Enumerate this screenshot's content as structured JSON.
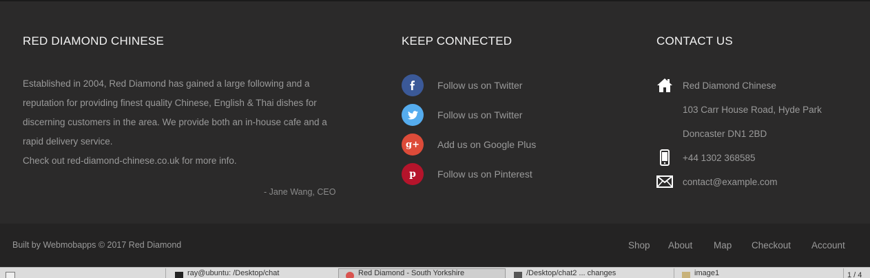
{
  "about": {
    "title": "RED DIAMOND CHINESE",
    "paragraph": "Established in 2004, Red Diamond has gained a large following and a reputation for providing finest quality Chinese, English & Thai dishes for discerning customers in the area. We provide both an in-house cafe and a rapid delivery service.",
    "more_info": "Check out red-diamond-chinese.co.uk for more info.",
    "quote_author": "- Jane Wang, CEO"
  },
  "social": {
    "title": "KEEP CONNECTED",
    "items": [
      {
        "icon": "facebook-icon",
        "glyph": "f",
        "color": "#3b5998",
        "label": "Follow us on Twitter"
      },
      {
        "icon": "twitter-icon",
        "glyph": "t",
        "color": "#55acee",
        "label": "Follow us on Twitter"
      },
      {
        "icon": "google-plus-icon",
        "glyph": "g+",
        "color": "#dd4b39",
        "label": "Add us on Google Plus"
      },
      {
        "icon": "pinterest-icon",
        "glyph": "p",
        "color": "#cb2027",
        "label": "Follow us on Pinterest"
      }
    ]
  },
  "contact": {
    "title": "CONTACT US",
    "name": "Red Diamond Chinese",
    "address_line1": "103 Carr House Road, Hyde Park",
    "address_line2": "Doncaster DN1 2BD",
    "phone": "+44 1302 368585",
    "email": "contact@example.com"
  },
  "bottom": {
    "copyright": "Built by Webmobapps © 2017 Red Diamond",
    "nav": [
      "Shop",
      "About",
      "Map",
      "Checkout",
      "Account"
    ]
  },
  "taskbar": {
    "items": [
      {
        "label": "ray@ubuntu: /Desktop/chat"
      },
      {
        "label": "Red Diamond - South Yorkshire"
      },
      {
        "label": "/Desktop/chat2 ... changes"
      },
      {
        "label": "image1"
      }
    ],
    "pager": "1 / 4"
  },
  "colors": {
    "background": "#2b2a2a",
    "bottom_bar": "#242323",
    "title_text": "#f2f2f2",
    "body_text": "#9a9a9a"
  }
}
